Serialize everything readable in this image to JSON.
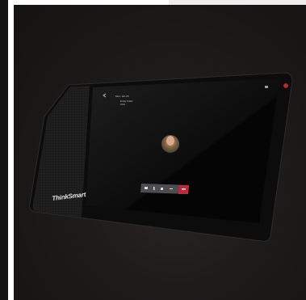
{
  "brand": {
    "name": "ThinkSmart"
  },
  "screen": {
    "status_time": "Mon, Jan 25",
    "call": {
      "contact_name": "Emily Fuller",
      "call_duration": "0:53",
      "controls": [
        {
          "name": "video-icon"
        },
        {
          "name": "mic-icon"
        },
        {
          "name": "volume-icon"
        },
        {
          "name": "minus-icon"
        },
        {
          "name": "end-call-icon"
        }
      ]
    }
  },
  "colors": {
    "background": "#1d1b1a",
    "bezel": "#0b0b0b",
    "fabric": "#1a1a1a",
    "end_call": "#c2263a",
    "control_bar": "#5c5c5f",
    "indicator": "#b22a2a"
  }
}
